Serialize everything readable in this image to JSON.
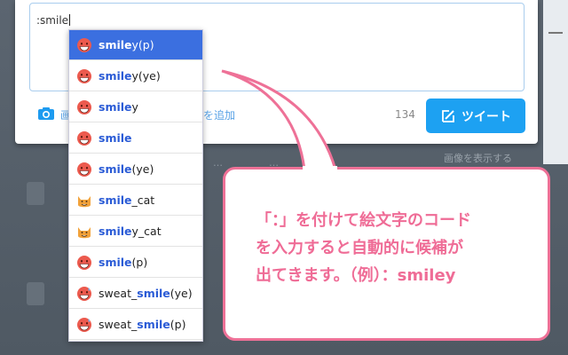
{
  "composer": {
    "text": ":smile",
    "media_label": "画",
    "media_label_tail": "を追加",
    "char_count": "134",
    "tweet_button": "ツイート"
  },
  "background": {
    "show_images": "画像を表示する"
  },
  "suggestions": [
    {
      "match": "smile",
      "rest": "y(p)",
      "prefix": "",
      "emoji": "smile-face"
    },
    {
      "match": "smile",
      "rest": "y(ye)",
      "prefix": "",
      "emoji": "smile-face"
    },
    {
      "match": "smile",
      "rest": "y",
      "prefix": "",
      "emoji": "smile-face"
    },
    {
      "match": "smile",
      "rest": "",
      "prefix": "",
      "emoji": "smile-face"
    },
    {
      "match": "smile",
      "rest": "(ye)",
      "prefix": "",
      "emoji": "smile-face"
    },
    {
      "match": "smile",
      "rest": "_cat",
      "prefix": "",
      "emoji": "cat-face"
    },
    {
      "match": "smile",
      "rest": "y_cat",
      "prefix": "",
      "emoji": "cat-face"
    },
    {
      "match": "smile",
      "rest": "(p)",
      "prefix": "",
      "emoji": "smile-face"
    },
    {
      "match": "smile",
      "rest": "(ye)",
      "prefix": "sweat_",
      "emoji": "sweat-smile-face"
    },
    {
      "match": "smile",
      "rest": "(p)",
      "prefix": "sweat_",
      "emoji": "sweat-smile-face"
    }
  ],
  "callout": {
    "line1": "「：」を付けて絵文字のコード",
    "line2": "を入力すると自動的に候補が",
    "line3": "出てきます。（例）：smiley"
  },
  "colors": {
    "accent": "#1da1f2",
    "selection": "#3b6fe0",
    "callout": "#ef6c96"
  }
}
